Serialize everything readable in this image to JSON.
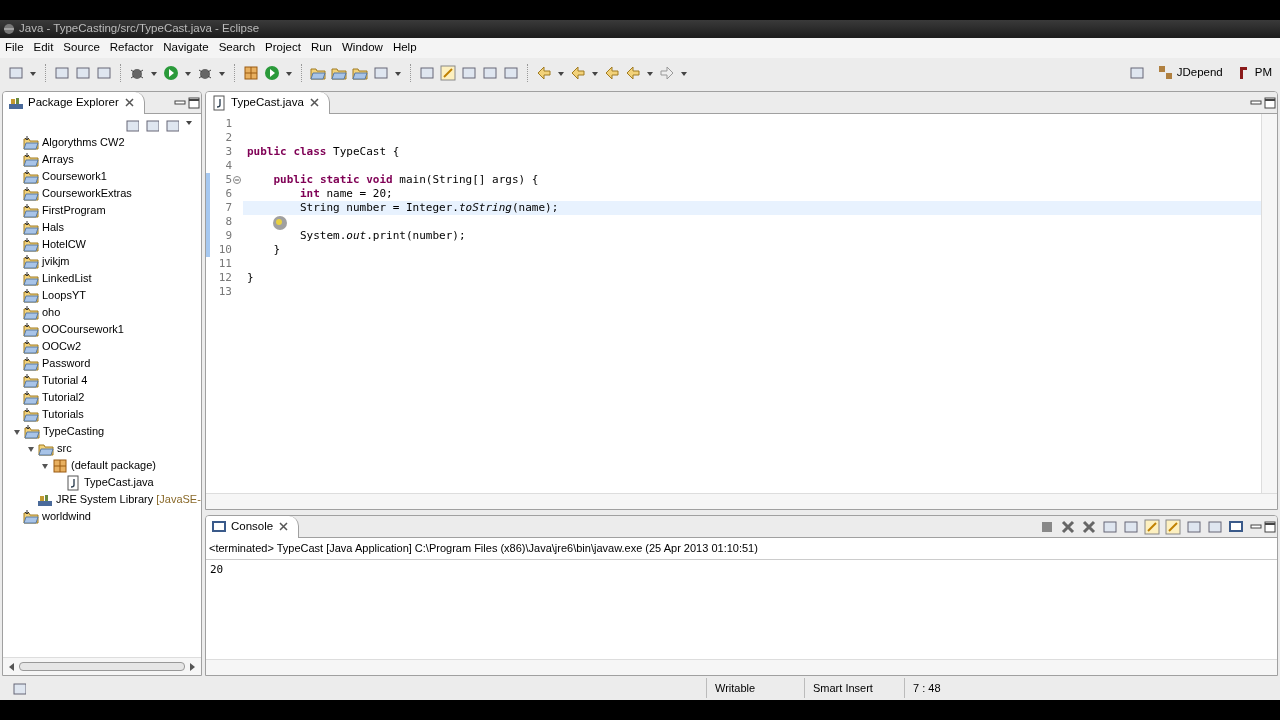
{
  "window": {
    "title": "Java - TypeCasting/src/TypeCast.java - Eclipse"
  },
  "menu": [
    "File",
    "Edit",
    "Source",
    "Refactor",
    "Navigate",
    "Search",
    "Project",
    "Run",
    "Window",
    "Help"
  ],
  "perspectives": [
    {
      "label": "JDepend",
      "selected": false
    },
    {
      "label": "PM",
      "selected": false
    }
  ],
  "package_explorer": {
    "title": "Package Explorer",
    "tree": [
      {
        "label": "Algorythms CW2",
        "kind": "project"
      },
      {
        "label": "Arrays",
        "kind": "project"
      },
      {
        "label": "Coursework1",
        "kind": "project"
      },
      {
        "label": "CourseworkExtras",
        "kind": "project"
      },
      {
        "label": "FirstProgram",
        "kind": "project"
      },
      {
        "label": "Hals",
        "kind": "project"
      },
      {
        "label": "HotelCW",
        "kind": "project"
      },
      {
        "label": "jvikjm",
        "kind": "project"
      },
      {
        "label": "LinkedList",
        "kind": "project"
      },
      {
        "label": "LoopsYT",
        "kind": "project"
      },
      {
        "label": "oho",
        "kind": "project"
      },
      {
        "label": "OOCoursework1",
        "kind": "project"
      },
      {
        "label": "OOCw2",
        "kind": "project"
      },
      {
        "label": "Password",
        "kind": "project"
      },
      {
        "label": "Tutorial 4",
        "kind": "project"
      },
      {
        "label": "Tutorial2",
        "kind": "project"
      },
      {
        "label": "Tutorials",
        "kind": "project"
      },
      {
        "label": "TypeCasting",
        "kind": "project",
        "expanded": true,
        "children": [
          {
            "label": "src",
            "kind": "folder",
            "expanded": true,
            "children": [
              {
                "label": "(default package)",
                "kind": "package",
                "expanded": true,
                "children": [
                  {
                    "label": "TypeCast.java",
                    "kind": "file"
                  }
                ]
              }
            ]
          },
          {
            "label": "JRE System Library",
            "suffix": "[JavaSE-",
            "kind": "library"
          }
        ]
      },
      {
        "label": "worldwind",
        "kind": "project"
      }
    ]
  },
  "editor": {
    "tab": {
      "label": "TypeCast.java",
      "selected": true
    },
    "lines": [
      {
        "number": "1"
      },
      {
        "number": "2"
      },
      {
        "number": "3",
        "code": "**public** **class** TypeCast {"
      },
      {
        "number": "4"
      },
      {
        "number": "5",
        "code": "    **public** **static** **void** main(String[] args) {",
        "in_scope": true,
        "foldable": true
      },
      {
        "number": "6",
        "code": "        **int** name = 20;",
        "in_scope": true
      },
      {
        "number": "7",
        "code": "        String number = Integer.*toString*(name);",
        "current": true,
        "in_scope": true
      },
      {
        "number": "8",
        "in_scope": true
      },
      {
        "number": "9",
        "code": "        System.*out*.print(number);",
        "in_scope": true
      },
      {
        "number": "10",
        "code": "    }",
        "in_scope": true
      },
      {
        "number": "11"
      },
      {
        "number": "12",
        "code": "}"
      },
      {
        "number": "13"
      }
    ]
  },
  "console": {
    "title": "Console",
    "header": "<terminated> TypeCast [Java Application] C:\\Program Files (x86)\\Java\\jre6\\bin\\javaw.exe (25 Apr 2013 01:10:51)",
    "output": "20"
  },
  "status_bar": [
    "Writable",
    "Smart Insert",
    "7 : 48"
  ]
}
